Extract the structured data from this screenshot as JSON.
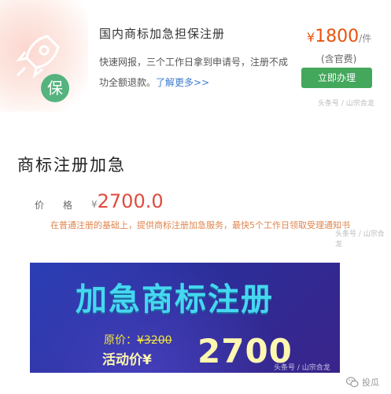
{
  "service_card": {
    "title": "国内商标加急担保注册",
    "desc_prefix": "快速网报，三个工作日拿到申请号，注册不成功全额退款。",
    "more_link": "了解更多>>",
    "badge": "保",
    "price_symbol": "¥",
    "price": "1800",
    "price_unit": "/件",
    "price_note": "(含官费)",
    "button_label": "立即办理",
    "watermark": "头条号 / 山宗合龙"
  },
  "listing": {
    "title": "商标注册加急",
    "price_label": "价格",
    "price_symbol": "¥",
    "price": "2700.0",
    "description": "在普通注册的基础上，提供商标注册加急服务，最快5个工作日领取受理通知书",
    "watermark": "头条号 / 山宗合龙"
  },
  "banner": {
    "headline": "加急商标注册",
    "original_price_label": "原价：",
    "original_price_value": "¥3200",
    "sale_price_label": "活动价¥",
    "sale_price_value": "2700",
    "watermark": "头条号 / 山宗合龙"
  },
  "footer": {
    "account": "投瓜",
    "icon": "wechat-icon"
  },
  "colors": {
    "accent_orange": "#e8530f",
    "button_green": "#43a85c",
    "banner_blue": "#2c3fb7",
    "banner_headline": "#45d8f0"
  }
}
